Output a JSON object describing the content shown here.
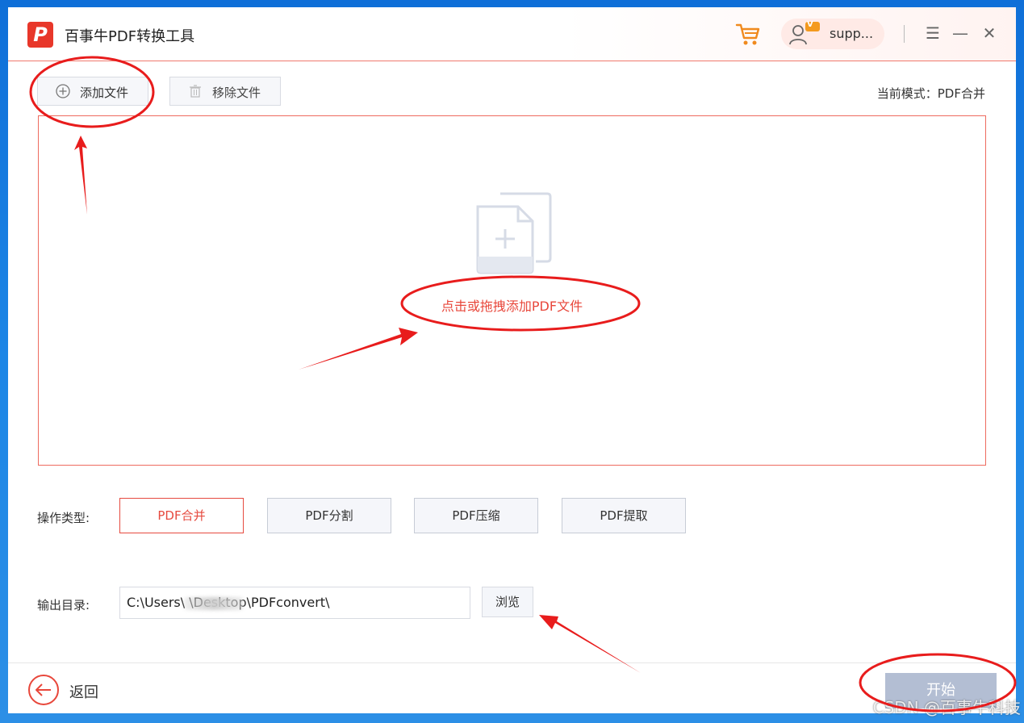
{
  "app": {
    "logo_letter": "P",
    "title": "百事牛PDF转换工具"
  },
  "header": {
    "cart_icon": "cart-icon",
    "user": {
      "name": "supp...",
      "badge": "V"
    },
    "menu_icon": "☰",
    "minimize_icon": "—",
    "close_icon": "✕"
  },
  "toolbar": {
    "add_label": "添加文件",
    "remove_label": "移除文件",
    "mode_text": "当前模式：PDF合并"
  },
  "dropzone": {
    "hint": "点击或拖拽添加PDF文件"
  },
  "operations": {
    "label": "操作类型:",
    "items": [
      {
        "label": "PDF合并",
        "active": true
      },
      {
        "label": "PDF分割",
        "active": false
      },
      {
        "label": "PDF压缩",
        "active": false
      },
      {
        "label": "PDF提取",
        "active": false
      }
    ]
  },
  "output": {
    "label": "输出目录:",
    "path": "C:\\Users\\            \\Desktop\\PDFconvert\\",
    "browse_label": "浏览"
  },
  "footer": {
    "back_label": "返回",
    "start_label": "开始"
  },
  "watermark": "CSDN @百事牛科技",
  "colors": {
    "accent": "#e8372a",
    "annotation": "#e81c1c",
    "start_disabled": "#b3bed3"
  }
}
